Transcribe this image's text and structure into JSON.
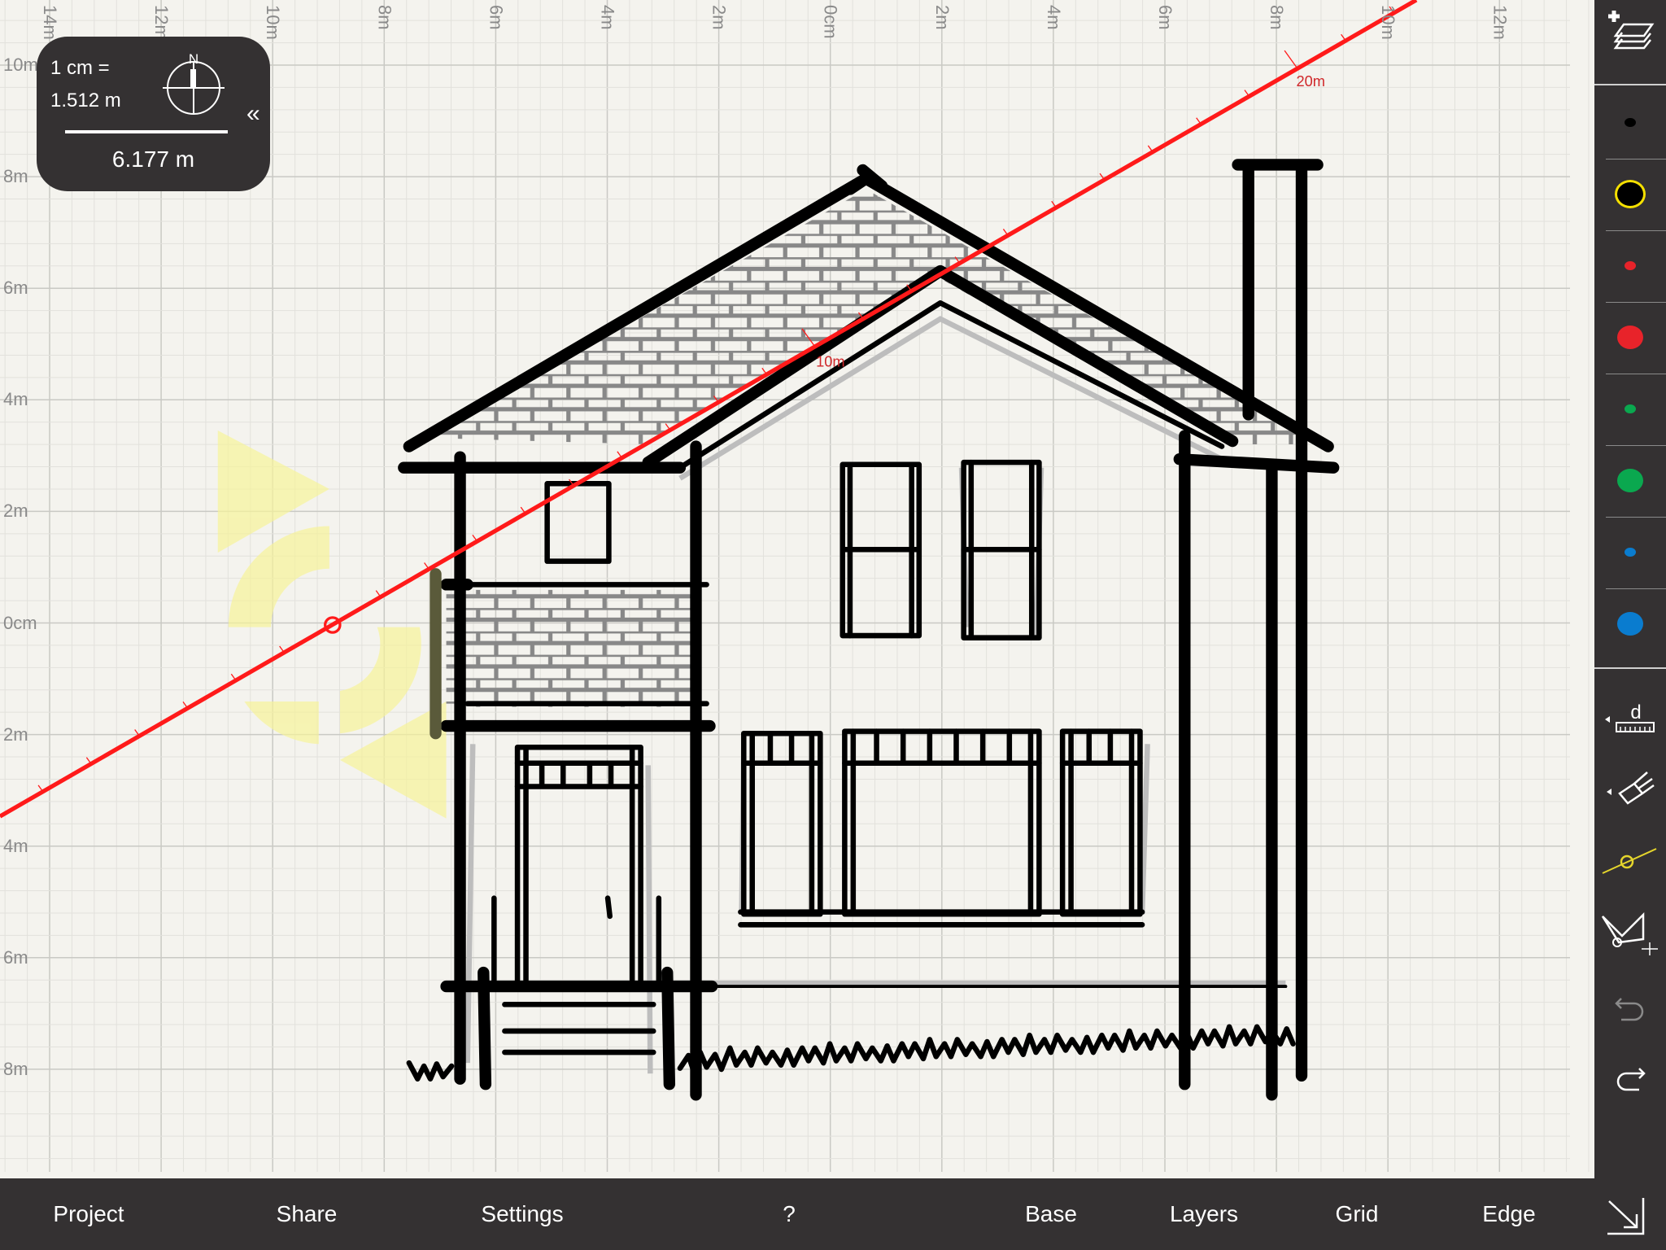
{
  "rulers": {
    "top": [
      "14m",
      "12m",
      "10m",
      "8m",
      "6m",
      "4m",
      "2m",
      "0cm",
      "2m",
      "4m",
      "6m",
      "8m",
      "10m",
      "12m"
    ],
    "left": [
      "10m",
      "8m",
      "6m",
      "4m",
      "2m",
      "0cm",
      "2m",
      "4m",
      "6m",
      "8m"
    ]
  },
  "measure_line": {
    "color": "#ff1a1a",
    "labels": [
      "10m",
      "20m"
    ]
  },
  "scale_panel": {
    "line1": "1 cm =",
    "line2": "1.512 m",
    "compass_label": "N",
    "distance": "6.177 m",
    "collapse": "«"
  },
  "toolbar": {
    "add_layer_icon": "add-layer-icon",
    "brushes": [
      {
        "color": "#000000",
        "size": "small"
      },
      {
        "color": "#000000",
        "size": "large",
        "selected": true,
        "ring": "#f5e000"
      },
      {
        "color": "#e8232a",
        "size": "small"
      },
      {
        "color": "#e8232a",
        "size": "large"
      },
      {
        "color": "#0aa84f",
        "size": "small"
      },
      {
        "color": "#0aa84f",
        "size": "large"
      },
      {
        "color": "#0a7ccf",
        "size": "small"
      },
      {
        "color": "#0a7ccf",
        "size": "large"
      }
    ],
    "tools": [
      "ruler-tool-icon",
      "eraser-tool-icon",
      "line-tool-icon",
      "selection-tool-icon",
      "undo-icon",
      "redo-icon"
    ],
    "ruler_label": "d"
  },
  "bottom_bar": {
    "items": [
      "Project",
      "Share",
      "Settings",
      "?",
      "Base",
      "Layers",
      "Grid",
      "Edge"
    ],
    "corner_icon": "resize-arrow-icon"
  }
}
